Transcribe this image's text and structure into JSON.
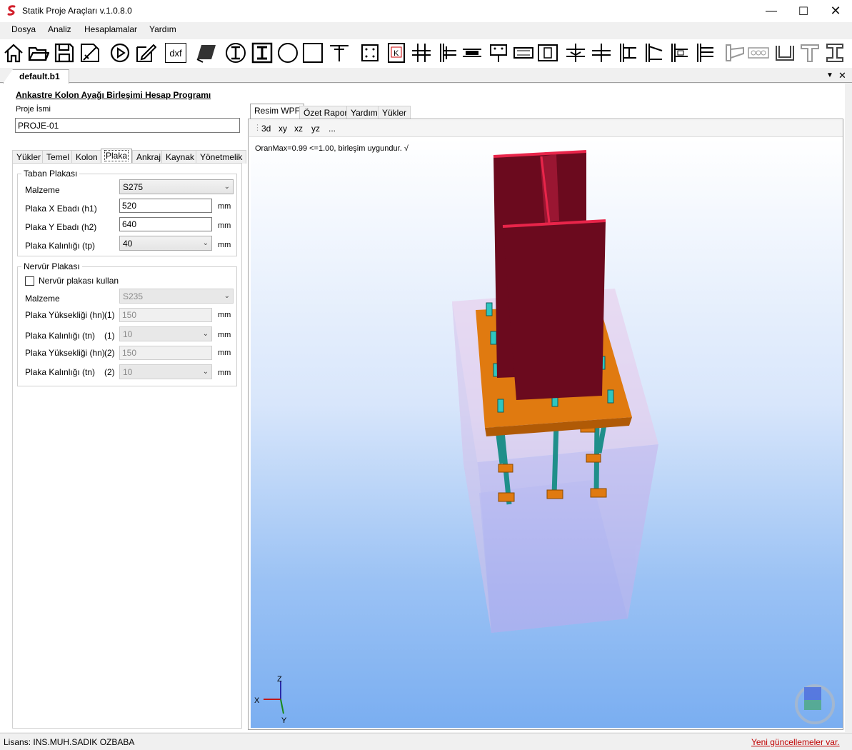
{
  "app": {
    "title": "Statik Proje Araçları v.1.0.8.0"
  },
  "menu": [
    "Dosya",
    "Analiz",
    "Hesaplamalar",
    "Yardım"
  ],
  "toolbar": {
    "icons": [
      "home-icon",
      "open-folder-icon",
      "save-icon",
      "edit-drawing-icon",
      "play-icon",
      "pencil-icon",
      "dxf-export-icon",
      "section-view-icon",
      "i-section-circle-icon",
      "i-section-box-icon",
      "circle-section-icon",
      "square-section-icon",
      "t-section-icon",
      "bolted-plate-icon",
      "k-connection-icon",
      "beam-column-icon-1",
      "beam-column-icon-2",
      "beam-splice-icon",
      "bolt-pattern-icon",
      "end-plate-icon",
      "column-base-icon",
      "beam-column-icon-3",
      "beam-column-icon-4",
      "beam-column-icon-5",
      "beam-column-icon-6",
      "beam-column-icon-7",
      "beam-column-icon-8",
      "beam-column-icon-9",
      "haunch-icon",
      "bolt-group-icon",
      "channel-section-icon",
      "t-beam-icon",
      "i-beam-icon"
    ],
    "dxf_label": "dxf"
  },
  "document": {
    "tab": "default.b1"
  },
  "left": {
    "program_title": "Ankastre Kolon Ayağı Birleşimi Hesap Programı",
    "project_label": "Proje İsmi",
    "project_name": "PROJE-01",
    "tabs": [
      "Yükler",
      "Temel",
      "Kolon",
      "Plaka",
      "Ankraj",
      "Kaynak",
      "Yönetmelik"
    ],
    "active_tab": "Plaka",
    "taban": {
      "legend": "Taban Plakası",
      "malzeme_label": "Malzeme",
      "malzeme_value": "S275",
      "x_label": "Plaka X Ebadı (h1)",
      "x_value": "520",
      "y_label": "Plaka Y Ebadı (h2)",
      "y_value": "640",
      "tp_label": "Plaka Kalınlığı (tp)",
      "tp_value": "40",
      "unit": "mm"
    },
    "nervur": {
      "legend": "Nervür Plakası",
      "checkbox_label": "Nervür plakası kullan",
      "checked": false,
      "malzeme_label": "Malzeme",
      "malzeme_value": "S235",
      "hn1_label": "Plaka Yüksekliği (hn)",
      "hn1_idx": "(1)",
      "hn1_value": "150",
      "tn1_label": "Plaka Kalınlığı (tn)",
      "tn1_idx": "(1)",
      "tn1_value": "10",
      "hn2_label": "Plaka Yüksekliği (hn)",
      "hn2_idx": "(2)",
      "hn2_value": "150",
      "tn2_label": "Plaka Kalınlığı (tn)",
      "tn2_idx": "(2)",
      "tn2_value": "10",
      "unit": "mm"
    }
  },
  "right": {
    "tabs": [
      "Resim WPF",
      "Özet Rapor",
      "Yardım",
      "Yükler"
    ],
    "active_tab": "Resim WPF",
    "view_buttons": [
      "3d",
      "xy",
      "xz",
      "yz",
      "..."
    ],
    "status_text": "OranMax=0.99 <=1.00, birleşim uygundur. √",
    "axes": {
      "z": "Z",
      "x": "X",
      "y": "Y"
    }
  },
  "statusbar": {
    "license": "Lisans: INS.MUH.SADIK OZBABA",
    "update": "Yeni güncellemeler var."
  },
  "colors": {
    "column": "#6b0a1e",
    "column_edge": "#e8254a",
    "base_plate": "#e07a10",
    "anchor_rod": "#1f8f8a",
    "bolt_head": "#2ec6c0",
    "concrete": "#d9b8e0",
    "viewport_bottom": "#7aaef1",
    "link": "#c00000"
  }
}
